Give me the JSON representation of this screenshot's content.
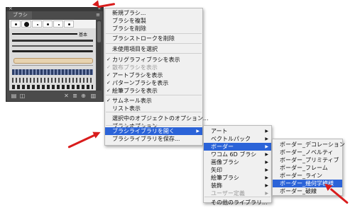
{
  "panel": {
    "tab": "ブラシ",
    "close_glyph": "×",
    "collapse_glyph": "«",
    "menu_glyph": "≡",
    "basic_label": "基本",
    "bottom_icons": [
      "brush-library-icon",
      "libraries-icon",
      "remove-stroke-icon",
      "options-icon",
      "new-brush-icon",
      "delete-icon"
    ]
  },
  "menu1": {
    "items": [
      {
        "label": "新規ブラシ..."
      },
      {
        "label": "ブラシを複製"
      },
      {
        "label": "ブラシを削除"
      },
      {
        "label": "ブラシストロークを削除"
      },
      {
        "label": "未使用項目を選択"
      },
      {
        "label": "カリグラフィブラシを表示",
        "checked": true
      },
      {
        "label": "散布ブラシを表示",
        "checked": true,
        "disabled": true
      },
      {
        "label": "アートブラシを表示",
        "checked": true
      },
      {
        "label": "パターンブラシを表示",
        "checked": true
      },
      {
        "label": "絵筆ブラシを表示",
        "checked": true
      },
      {
        "label": "サムネール表示",
        "checked": true
      },
      {
        "label": "リスト表示"
      },
      {
        "label": "選択中のオブジェクトのオプション..."
      },
      {
        "label": "ブラシオプション..."
      },
      {
        "label": "ブラシライブラリを開く",
        "highlighted": true,
        "submenu": true
      },
      {
        "label": "ブラシライブラリを保存..."
      }
    ]
  },
  "menu2": {
    "items": [
      {
        "label": "アート",
        "submenu": true
      },
      {
        "label": "ベクトルパック",
        "submenu": true
      },
      {
        "label": "ボーダー",
        "submenu": true,
        "highlighted": true
      },
      {
        "label": "ワコム 6D ブラシ",
        "submenu": true
      },
      {
        "label": "画像ブラシ",
        "submenu": true
      },
      {
        "label": "矢印",
        "submenu": true
      },
      {
        "label": "絵筆ブラシ",
        "submenu": true
      },
      {
        "label": "装飾",
        "submenu": true
      },
      {
        "label": "ユーザー定義",
        "submenu": true,
        "disabled": true
      },
      {
        "label": "その他のライブラリ..."
      }
    ]
  },
  "menu3": {
    "items": [
      {
        "label": "ボーダー_デコレーション"
      },
      {
        "label": "ボーダー_ノベルティ"
      },
      {
        "label": "ボーダー_プリミティブ"
      },
      {
        "label": "ボーダー_フレーム"
      },
      {
        "label": "ボーダー_ライン"
      },
      {
        "label": "ボーダー_幾何学模様",
        "highlighted": true
      },
      {
        "label": "ボーダー_破線"
      }
    ]
  },
  "colors": {
    "highlight": "#2b63d8",
    "annotation": "#d91c1c",
    "panel_bg": "#4b4b4b",
    "menu_bg": "#f0f0f0"
  }
}
